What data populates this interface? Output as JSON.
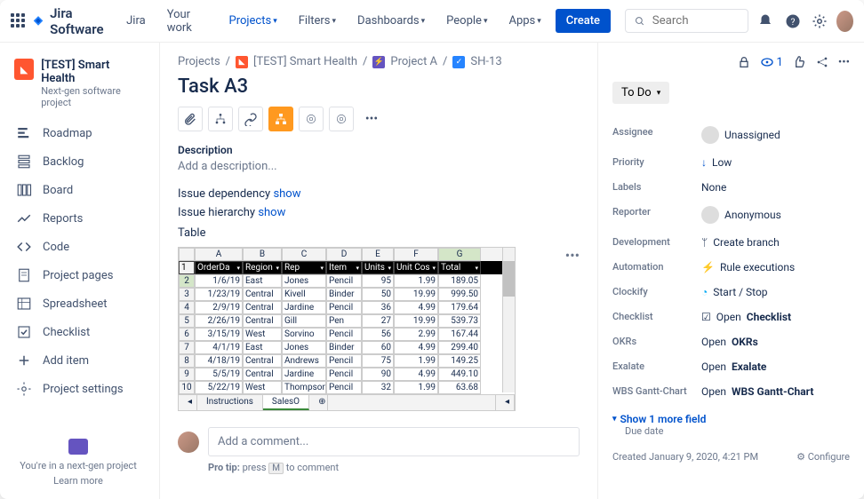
{
  "topnav": {
    "logo": "Jira Software",
    "items": [
      "Jira",
      "Your work",
      "Projects",
      "Filters",
      "Dashboards",
      "People",
      "Apps"
    ],
    "create": "Create",
    "search_ph": "Search"
  },
  "sidebar": {
    "project": "[TEST] Smart Health",
    "subtitle": "Next-gen software project",
    "items": [
      "Roadmap",
      "Backlog",
      "Board",
      "Reports",
      "Code",
      "Project pages",
      "Spreadsheet",
      "Checklist",
      "Add item",
      "Project settings"
    ],
    "foot1": "You're in a next-gen project",
    "foot2": "Learn more"
  },
  "crumb": {
    "projects": "Projects",
    "p1": "[TEST] Smart Health",
    "p2": "Project A",
    "p3": "SH-13"
  },
  "task": {
    "title": "Task A3",
    "desc_label": "Description",
    "desc_ph": "Add a description...",
    "dep": "Issue dependency",
    "dep_show": "show",
    "hier": "Issue hierarchy",
    "hier_show": "show",
    "table_label": "Table"
  },
  "sheet": {
    "cols": [
      "A",
      "B",
      "C",
      "D",
      "E",
      "F",
      "G"
    ],
    "headers": [
      "OrderDa",
      "Region",
      "Rep",
      "Item",
      "Units",
      "Unit Cos",
      "Total"
    ],
    "rows": [
      [
        "1/6/19",
        "East",
        "Jones",
        "Pencil",
        "95",
        "1.99",
        "189.05"
      ],
      [
        "1/23/19",
        "Central",
        "Kivell",
        "Binder",
        "50",
        "19.99",
        "999.50"
      ],
      [
        "2/9/19",
        "Central",
        "Jardine",
        "Pencil",
        "36",
        "4.99",
        "179.64"
      ],
      [
        "2/26/19",
        "Central",
        "Gill",
        "Pen",
        "27",
        "19.99",
        "539.73"
      ],
      [
        "3/15/19",
        "West",
        "Sorvino",
        "Pencil",
        "56",
        "2.99",
        "167.44"
      ],
      [
        "4/1/19",
        "East",
        "Jones",
        "Binder",
        "60",
        "4.99",
        "299.40"
      ],
      [
        "4/18/19",
        "Central",
        "Andrews",
        "Pencil",
        "75",
        "1.99",
        "149.25"
      ],
      [
        "5/5/19",
        "Central",
        "Jardine",
        "Pencil",
        "90",
        "4.99",
        "449.10"
      ],
      [
        "5/22/19",
        "West",
        "Thompson",
        "Pencil",
        "32",
        "1.99",
        "63.68"
      ]
    ],
    "tabs": [
      "Instructions",
      "SalesO"
    ]
  },
  "comment": {
    "ph": "Add a comment...",
    "tip_pre": "Pro tip:",
    "tip_press": "press",
    "tip_key": "M",
    "tip_post": "to comment"
  },
  "details": {
    "watch": "1",
    "status": "To Do",
    "fields": {
      "assignee": {
        "l": "Assignee",
        "v": "Unassigned"
      },
      "priority": {
        "l": "Priority",
        "v": "Low"
      },
      "labels": {
        "l": "Labels",
        "v": "None"
      },
      "reporter": {
        "l": "Reporter",
        "v": "Anonymous"
      },
      "dev": {
        "l": "Development",
        "v": "Create branch"
      },
      "auto": {
        "l": "Automation",
        "v": "Rule executions"
      },
      "clockify": {
        "l": "Clockify",
        "v": "Start / Stop"
      },
      "checklist": {
        "l": "Checklist",
        "v_pre": "Open ",
        "v": "Checklist"
      },
      "okrs": {
        "l": "OKRs",
        "v_pre": "Open ",
        "v": "OKRs"
      },
      "exalate": {
        "l": "Exalate",
        "v_pre": "Open ",
        "v": "Exalate"
      },
      "wbs": {
        "l": "WBS Gantt-Chart",
        "v_pre": "Open ",
        "v": "WBS Gantt-Chart"
      }
    },
    "more": "Show 1 more field",
    "due": "Due date",
    "created": "Created January 9, 2020, 4:21 PM",
    "configure": "Configure"
  }
}
